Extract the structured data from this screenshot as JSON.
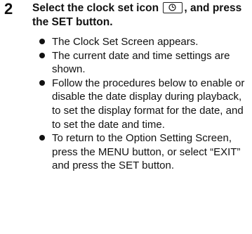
{
  "step": {
    "number": "2",
    "heading_before_icon": "Select the clock set icon ",
    "icon": "clock-set-icon",
    "heading_after_icon": ", and press the SET button."
  },
  "bullets": [
    "The Clock Set Screen appears.",
    "The current date and time settings are shown.",
    "Follow the procedures below to enable or disable the date display during playback, to set the display format for the date, and to set the date and time.",
    "To return to the Option Setting Screen, press the MENU button, or select “EXIT” and press the SET button."
  ]
}
